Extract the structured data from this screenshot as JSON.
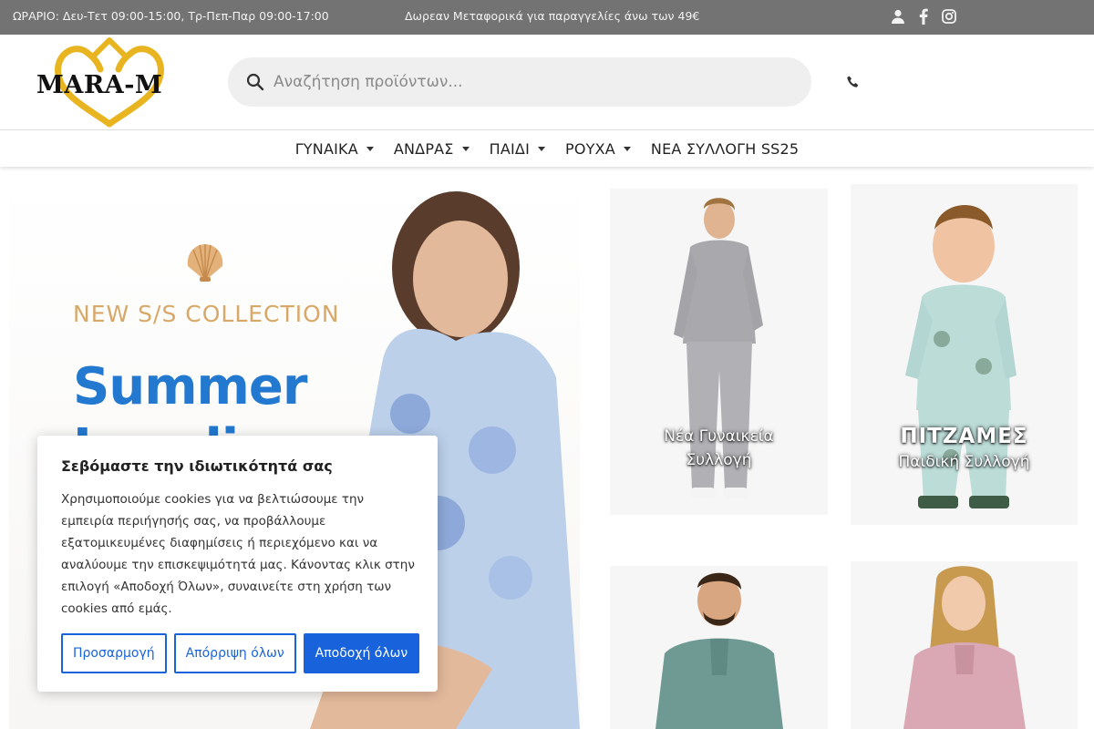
{
  "topbar": {
    "hours": "ΩΡΑΡΙΟ: Δευ-Τετ 09:00-15:00, Τρ-Πεπ-Παρ 09:00-17:00",
    "promo": "Δωρεαν Μεταφορικά για παραγγελίες άνω των 49€",
    "icons": [
      "user-icon",
      "facebook-icon",
      "instagram-icon"
    ]
  },
  "header": {
    "logo_text": "MARA-M",
    "search_placeholder": "Αναζήτηση προϊόντων...",
    "phone_icon": "phone-icon"
  },
  "nav": {
    "items": [
      {
        "label": "ΓΥΝΑΙΚΑ",
        "has_dropdown": true
      },
      {
        "label": "ΑΝΔΡΑΣ",
        "has_dropdown": true
      },
      {
        "label": "ΠΑΙΔΙ",
        "has_dropdown": true
      },
      {
        "label": "ΡΟΥΧΑ",
        "has_dropdown": true
      },
      {
        "label": "ΝΕΑ ΣΥΛΛΟΓΗ SS25",
        "has_dropdown": false
      }
    ]
  },
  "hero": {
    "collection": "NEW S/S COLLECTION",
    "headline": "Summer",
    "headline2": "Lovelies"
  },
  "tiles": [
    {
      "title": "Νέα Γυναικεία Συλλογή",
      "subtitle": ""
    },
    {
      "title": "ΠΙΤΖΑΜΕΣ",
      "subtitle": "Παιδική Συλλογή"
    },
    {
      "title": "",
      "subtitle": ""
    },
    {
      "title": "",
      "subtitle": ""
    }
  ],
  "cookie": {
    "title": "Σεβόμαστε την ιδιωτικότητά σας",
    "text": "Χρησιμοποιούμε cookies για να βελτιώσουμε την εμπειρία περιήγησής σας, να προβάλλουμε εξατομικευμένες διαφημίσεις ή περιεχόμενο και να αναλύουμε την επισκεψιμότητά μας. Κάνοντας κλικ στην επιλογή «Αποδοχή Όλων», συναινείτε στη χρήση των cookies από εμάς.",
    "customize": "Προσαρμογή",
    "reject": "Απόρριψη όλων",
    "accept": "Αποδοχή όλων"
  },
  "colors": {
    "topbar": "#737373",
    "accent_blue": "#1863dc",
    "headline_blue": "#2378cf",
    "collection_gold": "#d8a868",
    "logo_gold": "#e8b520"
  }
}
